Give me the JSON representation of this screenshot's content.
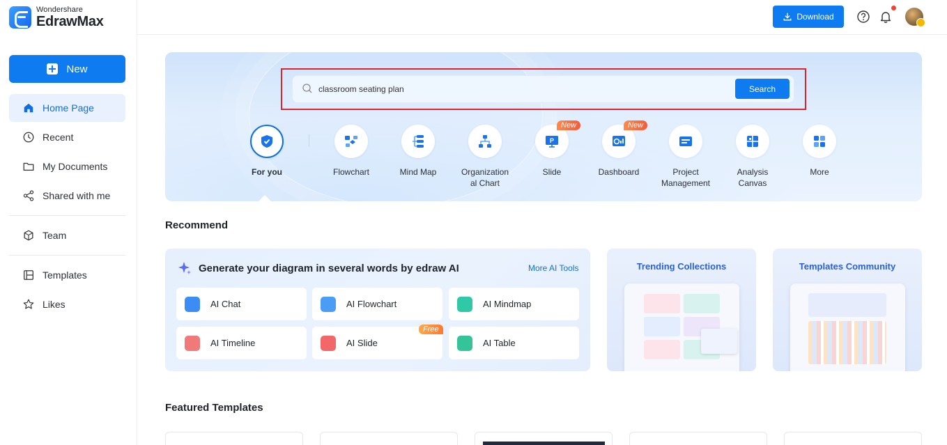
{
  "app": {
    "brand_sub": "Wondershare",
    "brand_main": "EdrawMax"
  },
  "sidebar": {
    "new_label": "New",
    "items": [
      {
        "label": "Home Page",
        "icon": "home-icon"
      },
      {
        "label": "Recent",
        "icon": "clock-icon"
      },
      {
        "label": "My Documents",
        "icon": "folder-icon"
      },
      {
        "label": "Shared with me",
        "icon": "share-icon"
      },
      {
        "label": "Team",
        "icon": "team-icon"
      },
      {
        "label": "Templates",
        "icon": "templates-icon"
      },
      {
        "label": "Likes",
        "icon": "star-icon"
      }
    ]
  },
  "header": {
    "download_label": "Download"
  },
  "search": {
    "value": "classroom seating plan",
    "button": "Search"
  },
  "categories": [
    {
      "label": "For you",
      "icon": "for-you-icon"
    },
    {
      "label": "Flowchart",
      "icon": "flowchart-icon"
    },
    {
      "label": "Mind Map",
      "icon": "mind-map-icon"
    },
    {
      "label": "Organization al Chart",
      "icon": "org-chart-icon"
    },
    {
      "label": "Slide",
      "icon": "slide-icon",
      "badge": "New"
    },
    {
      "label": "Dashboard",
      "icon": "dashboard-icon",
      "badge": "New"
    },
    {
      "label": "Project Management",
      "icon": "project-icon"
    },
    {
      "label": "Analysis Canvas",
      "icon": "analysis-icon"
    },
    {
      "label": "More",
      "icon": "more-icon"
    }
  ],
  "recommend": {
    "title": "Recommend",
    "ai_heading": "Generate your diagram in several words by edraw AI",
    "more_ai": "More AI Tools",
    "tools": [
      {
        "label": "AI Chat",
        "color": "#3b8df5"
      },
      {
        "label": "AI Flowchart",
        "color": "#4b9cf5"
      },
      {
        "label": "AI Mindmap",
        "color": "#2fc9a7"
      },
      {
        "label": "AI Timeline",
        "color": "#f07a7a"
      },
      {
        "label": "AI Slide",
        "color": "#f26868",
        "badge": "Free"
      },
      {
        "label": "AI Table",
        "color": "#35c49a"
      }
    ],
    "trending": "Trending Collections",
    "community": "Templates Community"
  },
  "featured": {
    "title": "Featured Templates"
  }
}
